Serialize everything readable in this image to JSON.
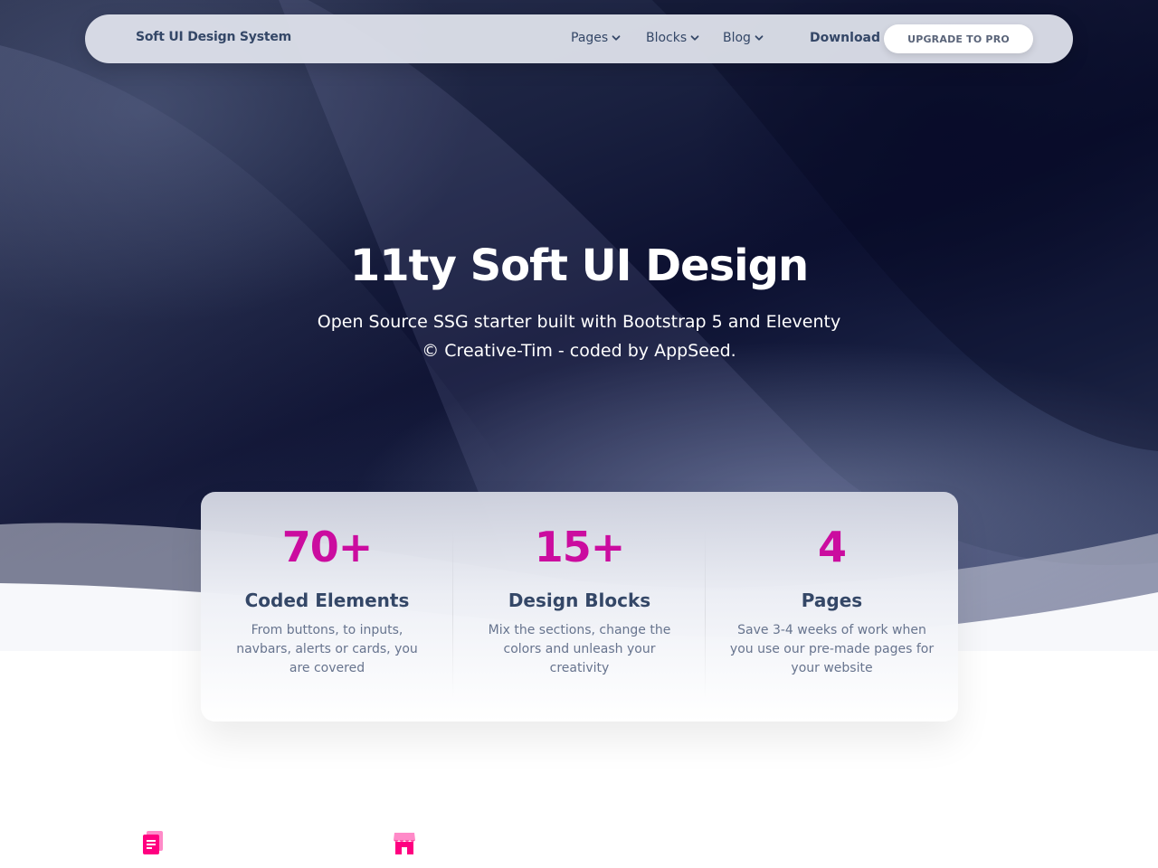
{
  "navbar": {
    "brand": "Soft UI Design System",
    "items": [
      {
        "label": "Pages"
      },
      {
        "label": "Blocks"
      },
      {
        "label": "Blog"
      }
    ],
    "download": "Download",
    "upgrade_button": "UPGRADE TO PRO"
  },
  "hero": {
    "title": "11ty Soft UI Design",
    "subtitle_line1": "Open Source SSG starter built with Bootstrap 5 and Eleventy",
    "subtitle_line2": "© Creative-Tim - coded by AppSeed."
  },
  "stats": [
    {
      "number": "70+",
      "label": "Coded Elements",
      "description": "From buttons, to inputs, navbars, alerts or cards, you are covered"
    },
    {
      "number": "15+",
      "label": "Design Blocks",
      "description": "Mix the sections, change the colors and unleash your creativity"
    },
    {
      "number": "4",
      "label": "Pages",
      "description": "Save 3-4 weeks of work when you use our pre-made pages for your website"
    }
  ],
  "features": [
    {
      "icon": "document-icon"
    },
    {
      "icon": "shop-icon"
    }
  ],
  "colors": {
    "accent": "#cb0c9f",
    "heading": "#344767",
    "text_muted": "#67748e",
    "icon_pink": "#ff0080"
  }
}
